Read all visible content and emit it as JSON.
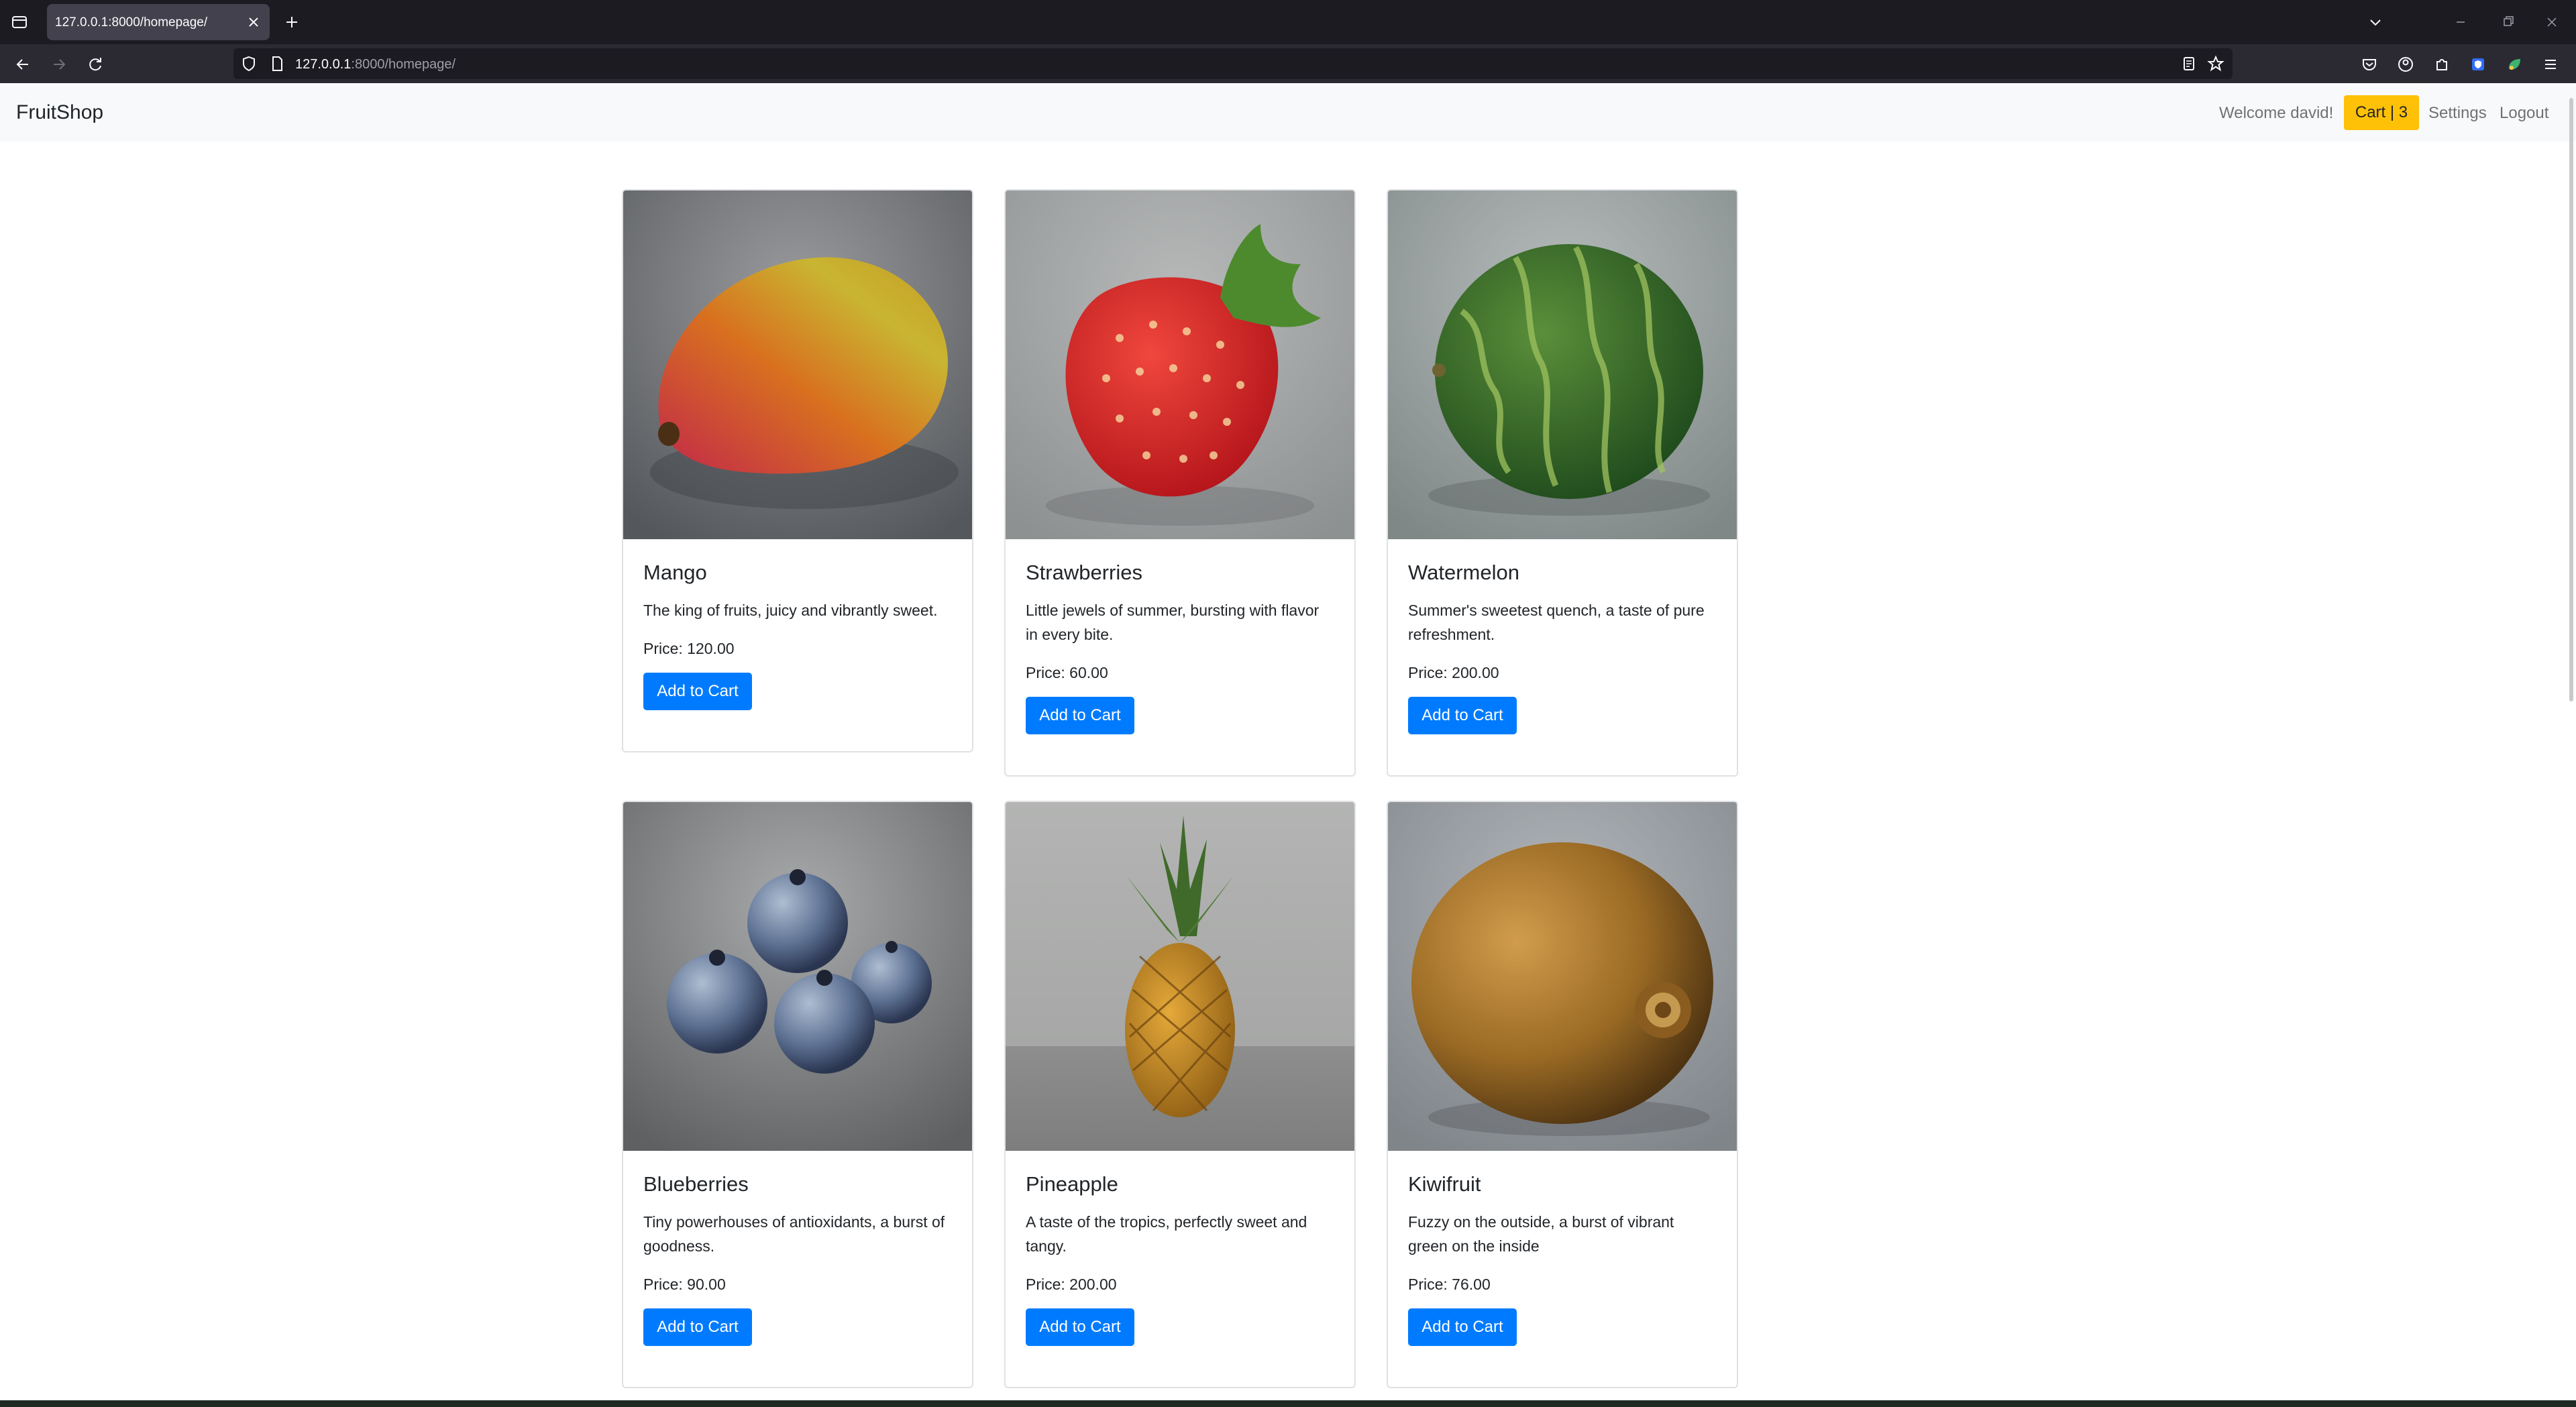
{
  "browser": {
    "tab_title": "127.0.0.1:8000/homepage/",
    "url_host": "127.0.0.1",
    "url_path": ":8000/homepage/"
  },
  "site": {
    "brand": "FruitShop",
    "welcome": "Welcome david!",
    "cart_label": "Cart | 3",
    "settings": "Settings",
    "logout": "Logout",
    "accent_color": "#007bff",
    "cart_color": "#ffc107"
  },
  "products": [
    {
      "name": "Mango",
      "description": "The king of fruits, juicy and vibrantly sweet.",
      "price": "Price: 120.00",
      "button": "Add to Cart",
      "image": "mango-image"
    },
    {
      "name": "Strawberries",
      "description": "Little jewels of summer, bursting with flavor in every bite.",
      "price": "Price: 60.00",
      "button": "Add to Cart",
      "image": "strawberry-image"
    },
    {
      "name": "Watermelon",
      "description": "Summer's sweetest quench, a taste of pure refreshment.",
      "price": "Price: 200.00",
      "button": "Add to Cart",
      "image": "watermelon-image"
    },
    {
      "name": "Blueberries",
      "description": "Tiny powerhouses of antioxidants, a burst of goodness.",
      "price": "Price: 90.00",
      "button": "Add to Cart",
      "image": "blueberries-image"
    },
    {
      "name": "Pineapple",
      "description": "A taste of the tropics, perfectly sweet and tangy.",
      "price": "Price: 200.00",
      "button": "Add to Cart",
      "image": "pineapple-image"
    },
    {
      "name": "Kiwifruit",
      "description": "Fuzzy on the outside, a burst of vibrant green on the inside",
      "price": "Price: 76.00",
      "button": "Add to Cart",
      "image": "kiwi-image"
    }
  ]
}
